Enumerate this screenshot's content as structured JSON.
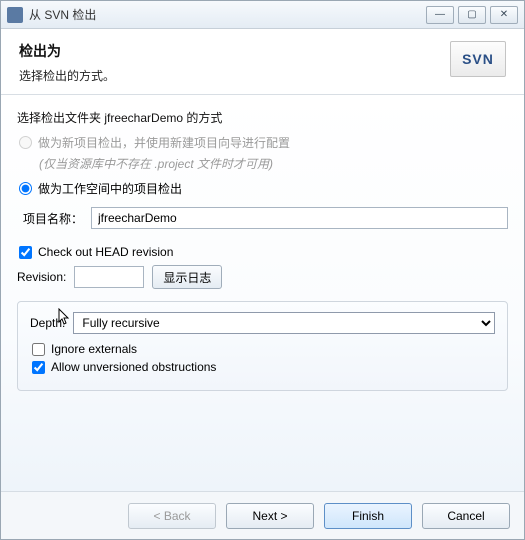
{
  "titlebar": {
    "title": "从 SVN 检出"
  },
  "banner": {
    "title": "检出为",
    "subtitle": "选择检出的方式。",
    "logo_text": "SVN"
  },
  "checkout": {
    "section_label": "选择检出文件夹 jfreecharDemo 的方式",
    "radio_new_project": "做为新项目检出，并使用新建项目向导进行配置",
    "hint": "(仅当资源库中不存在 .project 文件时才可用)",
    "radio_workspace": "做为工作空间中的项目检出",
    "project_name_label": "项目名称：",
    "project_name_value": "jfreecharDemo"
  },
  "revision": {
    "check_head": "Check out HEAD revision",
    "revision_label": "Revision:",
    "revision_value": "",
    "show_log_btn": "显示日志"
  },
  "depth": {
    "label": "Depth:",
    "selected": "Fully recursive",
    "ignore_externals": "Ignore externals",
    "allow_unversioned": "Allow unversioned obstructions"
  },
  "buttons": {
    "back": "< Back",
    "next": "Next >",
    "finish": "Finish",
    "cancel": "Cancel"
  }
}
